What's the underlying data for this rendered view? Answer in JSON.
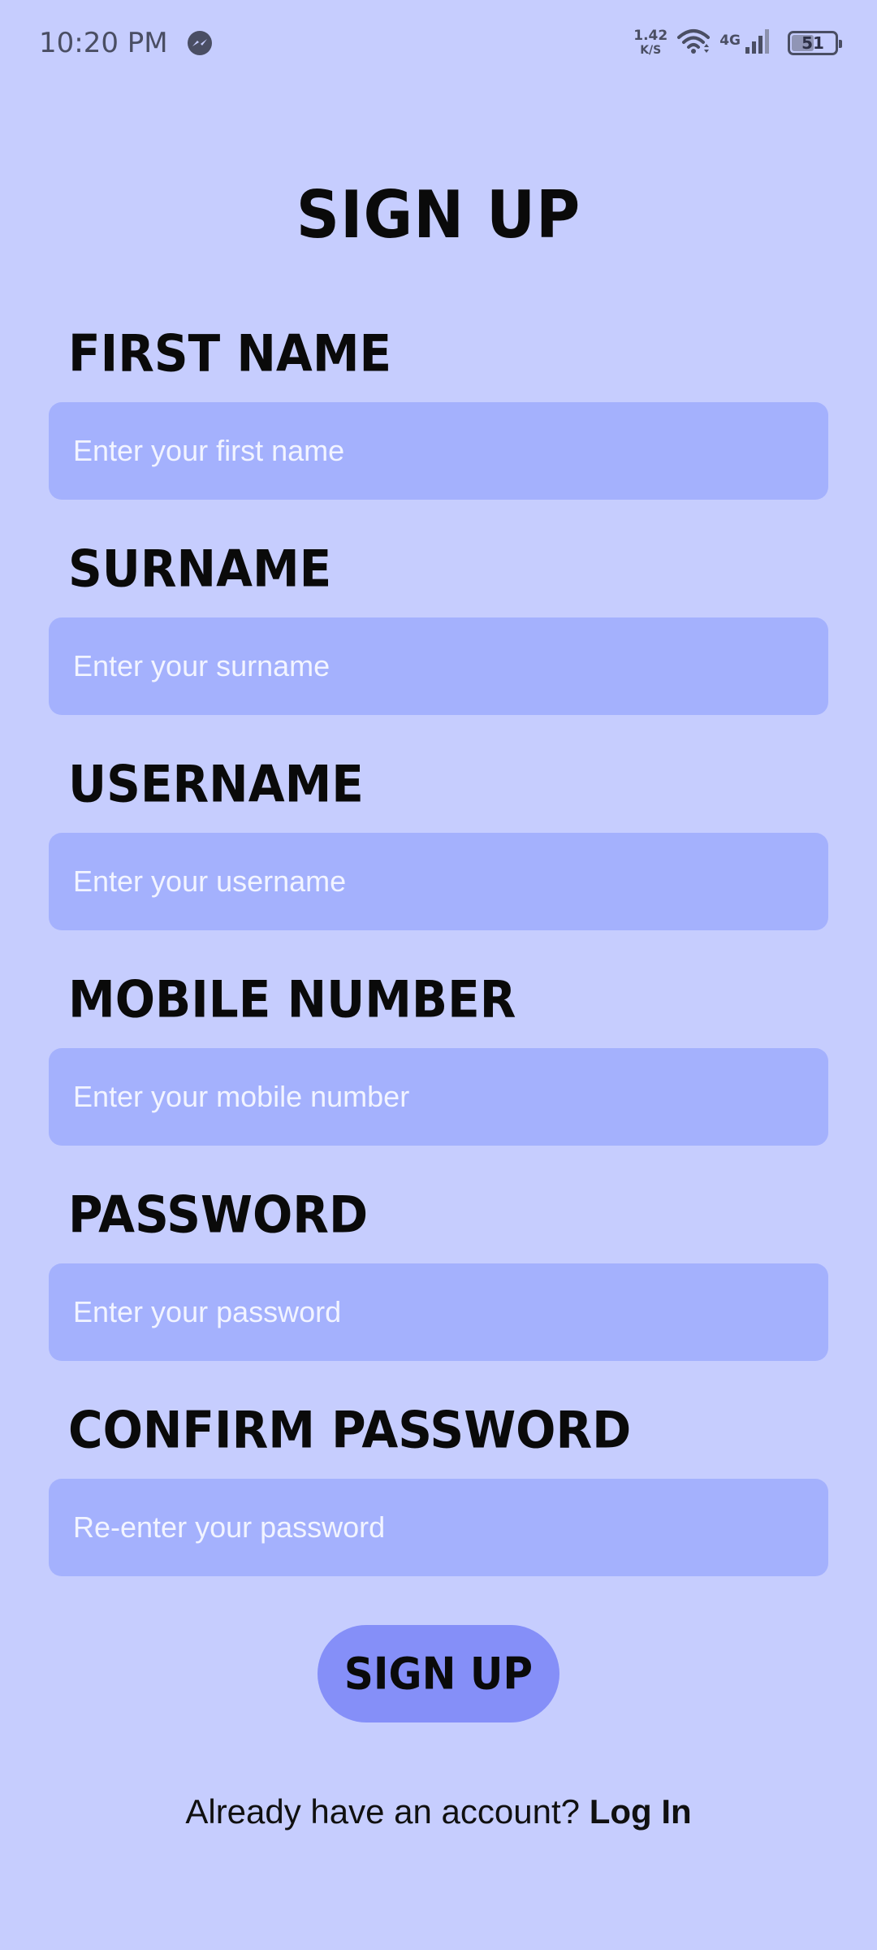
{
  "status_bar": {
    "time": "10:20 PM",
    "net_speed_value": "1.42",
    "net_speed_unit": "K/S",
    "cell_type": "4G",
    "battery_level": "51"
  },
  "title": "SIGN UP",
  "fields": [
    {
      "label": "FIRST NAME",
      "placeholder": "Enter your first name",
      "value": ""
    },
    {
      "label": "SURNAME",
      "placeholder": "Enter your surname",
      "value": ""
    },
    {
      "label": "USERNAME",
      "placeholder": "Enter your username",
      "value": ""
    },
    {
      "label": "MOBILE NUMBER",
      "placeholder": "Enter your mobile number",
      "value": ""
    },
    {
      "label": "PASSWORD",
      "placeholder": "Enter your password",
      "value": ""
    },
    {
      "label": "CONFIRM PASSWORD",
      "placeholder": "Re-enter your password",
      "value": ""
    }
  ],
  "signup_button_label": "SIGN UP",
  "footer": {
    "prompt": "Already have an account?",
    "link_label": "Log In"
  },
  "icons": {
    "notification": "messenger-icon",
    "wifi": "wifi-icon",
    "signal": "signal-icon",
    "battery": "battery-icon"
  },
  "colors": {
    "background": "#c6cdfe",
    "input_fill": "#a4b1fd",
    "button_fill": "#858ff8",
    "text": "#0a0a0a"
  }
}
